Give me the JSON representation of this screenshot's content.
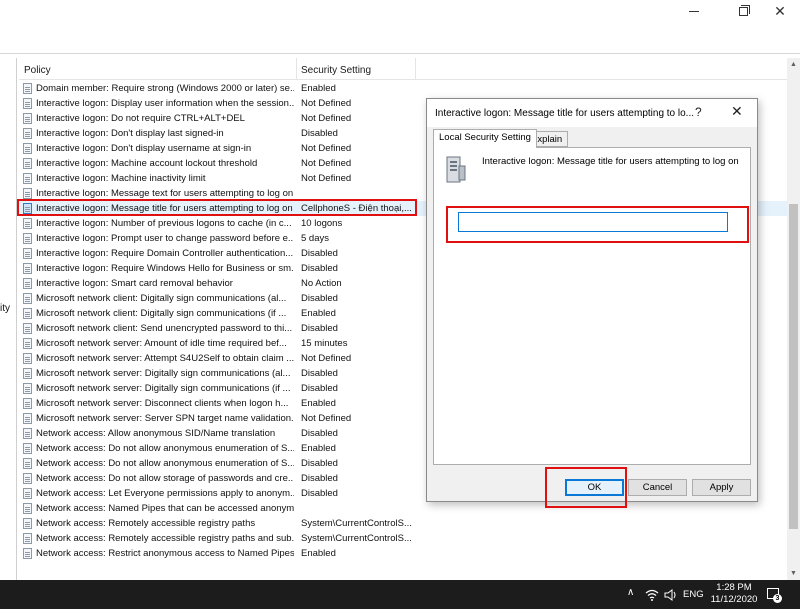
{
  "window": {
    "min_icon": "minimize-icon",
    "max_icon": "restore-icon",
    "close_glyph": "✕"
  },
  "left_pane": {
    "fragment": "ity"
  },
  "list": {
    "header": {
      "policy": "Policy",
      "setting": "Security Setting"
    },
    "rows": [
      {
        "policy": "Domain member: Require strong (Windows 2000 or later) se...",
        "setting": "Enabled"
      },
      {
        "policy": "Interactive logon: Display user information when the session...",
        "setting": "Not Defined"
      },
      {
        "policy": "Interactive logon: Do not require CTRL+ALT+DEL",
        "setting": "Not Defined"
      },
      {
        "policy": "Interactive logon: Don't display last signed-in",
        "setting": "Disabled"
      },
      {
        "policy": "Interactive logon: Don't display username at sign-in",
        "setting": "Not Defined"
      },
      {
        "policy": "Interactive logon: Machine account lockout threshold",
        "setting": "Not Defined"
      },
      {
        "policy": "Interactive logon: Machine inactivity limit",
        "setting": "Not Defined"
      },
      {
        "policy": "Interactive logon: Message text for users attempting to log on",
        "setting": ""
      },
      {
        "policy": "Interactive logon: Message title for users attempting to log on",
        "setting": "CellphoneS - Điện thoại,..."
      },
      {
        "policy": "Interactive logon: Number of previous logons to cache (in c...",
        "setting": "10 logons"
      },
      {
        "policy": "Interactive logon: Prompt user to change password before e...",
        "setting": "5 days"
      },
      {
        "policy": "Interactive logon: Require Domain Controller authentication...",
        "setting": "Disabled"
      },
      {
        "policy": "Interactive logon: Require Windows Hello for Business or sm...",
        "setting": "Disabled"
      },
      {
        "policy": "Interactive logon: Smart card removal behavior",
        "setting": "No Action"
      },
      {
        "policy": "Microsoft network client: Digitally sign communications (al...",
        "setting": "Disabled"
      },
      {
        "policy": "Microsoft network client: Digitally sign communications (if ...",
        "setting": "Enabled"
      },
      {
        "policy": "Microsoft network client: Send unencrypted password to thi...",
        "setting": "Disabled"
      },
      {
        "policy": "Microsoft network server: Amount of idle time required bef...",
        "setting": "15 minutes"
      },
      {
        "policy": "Microsoft network server: Attempt S4U2Self to obtain claim ...",
        "setting": "Not Defined"
      },
      {
        "policy": "Microsoft network server: Digitally sign communications (al...",
        "setting": "Disabled"
      },
      {
        "policy": "Microsoft network server: Digitally sign communications (if ...",
        "setting": "Disabled"
      },
      {
        "policy": "Microsoft network server: Disconnect clients when logon h...",
        "setting": "Enabled"
      },
      {
        "policy": "Microsoft network server: Server SPN target name validation...",
        "setting": "Not Defined"
      },
      {
        "policy": "Network access: Allow anonymous SID/Name translation",
        "setting": "Disabled"
      },
      {
        "policy": "Network access: Do not allow anonymous enumeration of S...",
        "setting": "Enabled"
      },
      {
        "policy": "Network access: Do not allow anonymous enumeration of S...",
        "setting": "Disabled"
      },
      {
        "policy": "Network access: Do not allow storage of passwords and cre...",
        "setting": "Disabled"
      },
      {
        "policy": "Network access: Let Everyone permissions apply to anonym...",
        "setting": "Disabled"
      },
      {
        "policy": "Network access: Named Pipes that can be accessed anonym...",
        "setting": ""
      },
      {
        "policy": "Network access: Remotely accessible registry paths",
        "setting": "System\\CurrentControlS..."
      },
      {
        "policy": "Network access: Remotely accessible registry paths and sub...",
        "setting": "System\\CurrentControlS..."
      },
      {
        "policy": "Network access: Restrict anonymous access to Named Pipes...",
        "setting": "Enabled"
      }
    ]
  },
  "dialog": {
    "title": "Interactive logon: Message title for users attempting to log on",
    "title_truncated": "Interactive logon: Message title for users attempting to lo...",
    "help": "?",
    "close": "✕",
    "tabs": [
      "Local Security Setting",
      "Explain"
    ],
    "description": "Interactive logon: Message title for users attempting to log on",
    "field_value": "",
    "buttons": {
      "ok": "OK",
      "cancel": "Cancel",
      "apply": "Apply"
    }
  },
  "taskbar": {
    "chevron": "∧",
    "lang": "ENG",
    "time": "1:28 PM",
    "date": "11/12/2020",
    "notification_count": "3"
  },
  "colors": {
    "highlight": "#e01010",
    "accent": "#0a78d7",
    "taskbar": "#1c1c1c"
  }
}
